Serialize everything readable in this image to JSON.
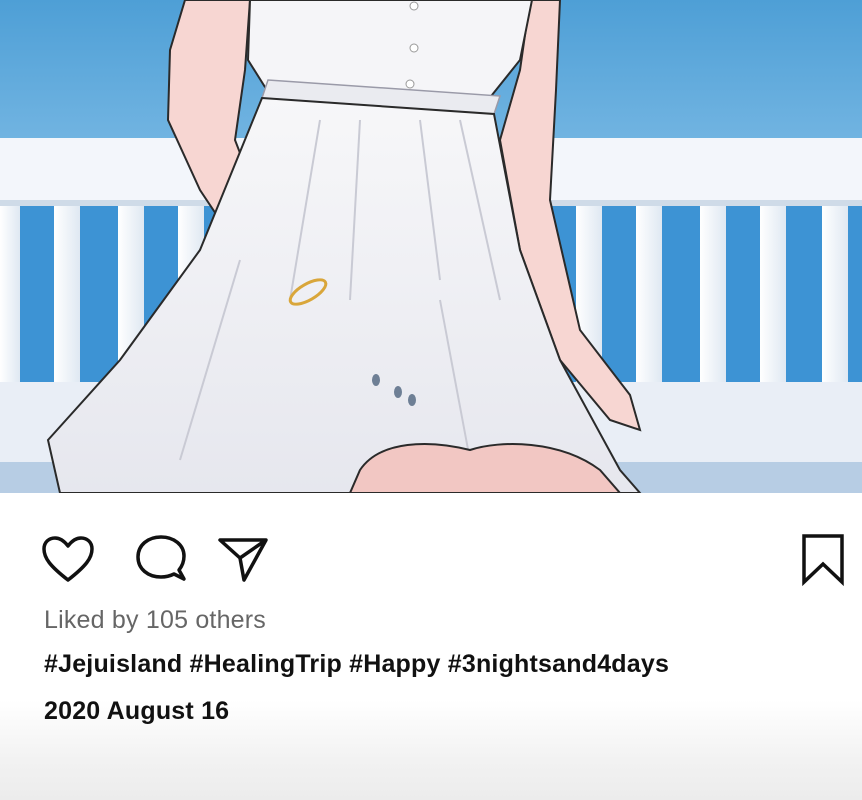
{
  "post": {
    "photo_alt": "Illustration of a woman in a white sundress seated in front of a white railing and blue sky",
    "actions": {
      "like_icon": "heart-icon",
      "comment_icon": "speech-bubble-icon",
      "share_icon": "paper-plane-icon",
      "save_icon": "bookmark-icon"
    },
    "likes_text": "Liked by 105 others",
    "caption": "#Jejuisland #HealingTrip #Happy #3nightsand4days",
    "date": "2020 August 16"
  },
  "colors": {
    "sky": "#5aaad8",
    "railing": "#f4f6fa",
    "dress": "#f1f1f4",
    "skin": "#f6d2ce",
    "icon_stroke": "#111111",
    "likes_text": "#666666"
  }
}
